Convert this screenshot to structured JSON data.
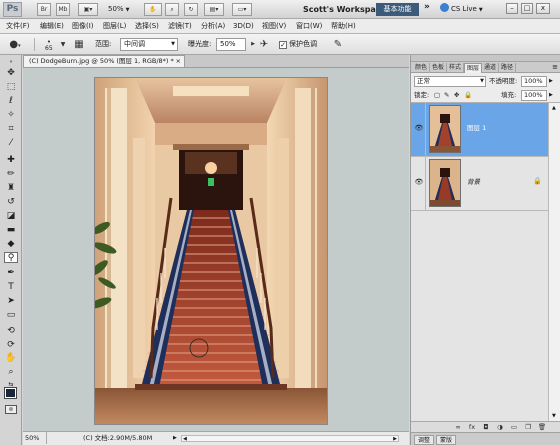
{
  "app_bar": {
    "logo": "Ps",
    "bridge_btn": "Br",
    "minibridge_btn": "Mb",
    "zoom_value": "50%",
    "workspace_name": "Scott's Workspace",
    "essentials_label": "基本功能",
    "more_label": "»",
    "cslive_label": "CS Live",
    "minimize": "–",
    "restore": "□",
    "close": "x"
  },
  "menus": [
    "文件(F)",
    "编辑(E)",
    "图像(I)",
    "图层(L)",
    "选择(S)",
    "滤镜(T)",
    "分析(A)",
    "3D(D)",
    "视图(V)",
    "窗口(W)",
    "帮助(H)"
  ],
  "options": {
    "brush_size": "65",
    "range_label": "范围:",
    "range_value": "中间调",
    "exposure_label": "曝光度:",
    "exposure_value": "50%",
    "protect_tones_label": "保护色调",
    "protect_tones_checked": true
  },
  "document": {
    "tab_title": "(C) DodgeBurn.jpg @ 50% (图层 1, RGB/8*) *",
    "tab_close": "×",
    "status_zoom": "50%",
    "status_doc": "(C) 文档:2.90M/5.80M"
  },
  "colors": {
    "foreground": "#17263b",
    "background": "#ffffff",
    "selection": "#6aa6e7",
    "workspace_accent": "#3c5a7a"
  },
  "panel_tabs": [
    "颜色",
    "色板",
    "样式",
    "图层",
    "通道",
    "路径"
  ],
  "active_panel_tab": "图层",
  "layers_panel": {
    "blend_mode": "正常",
    "opacity_label": "不透明度:",
    "opacity_value": "100%",
    "lock_label": "锁定:",
    "fill_label": "填充:",
    "fill_value": "100%",
    "layers": [
      {
        "name": "图层 1",
        "selected": true,
        "visible": true,
        "locked": false
      },
      {
        "name": "背景",
        "selected": false,
        "visible": true,
        "locked": true
      }
    ]
  },
  "bottom_tabs": [
    "调整",
    "蒙版"
  ],
  "icons": {
    "tool_preset": "dodge-tool-icon",
    "brush_preset": "brush-picker-icon",
    "airbrush": "airbrush-icon",
    "tablet_pressure": "pressure-icon"
  }
}
